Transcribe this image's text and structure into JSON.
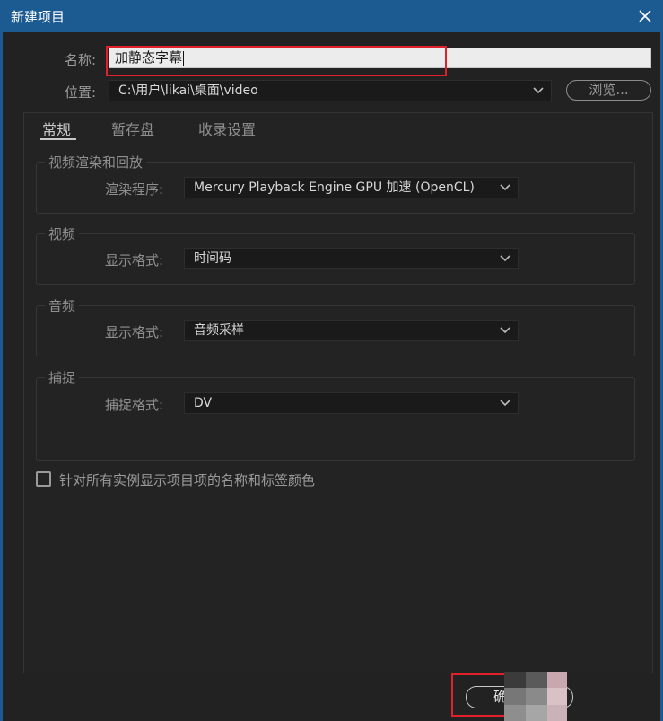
{
  "window": {
    "title": "新建项目",
    "close_icon": "close-icon",
    "accent_color": "#1c5b92"
  },
  "name_row": {
    "label": "名称:",
    "value": "加静态字幕"
  },
  "location_row": {
    "label": "位置:",
    "value": "C:\\用户\\likai\\桌面\\video",
    "browse_label": "浏览..."
  },
  "tabs": [
    {
      "label": "常规",
      "active": true
    },
    {
      "label": "暂存盘",
      "active": false
    },
    {
      "label": "收录设置",
      "active": false
    }
  ],
  "groups": {
    "render": {
      "title": "视频渲染和回放",
      "field_label": "渲染程序:",
      "value": "Mercury Playback Engine GPU 加速 (OpenCL)"
    },
    "video": {
      "title": "视频",
      "field_label": "显示格式:",
      "value": "时间码"
    },
    "audio": {
      "title": "音频",
      "field_label": "显示格式:",
      "value": "音频采样"
    },
    "capture": {
      "title": "捕捉",
      "field_label": "捕捉格式:",
      "value": "DV"
    }
  },
  "checkbox": {
    "label": "针对所有实例显示项目项的名称和标签颜色",
    "checked": false
  },
  "footer": {
    "ok_label": "确"
  },
  "annotation_color": "#e0202a"
}
